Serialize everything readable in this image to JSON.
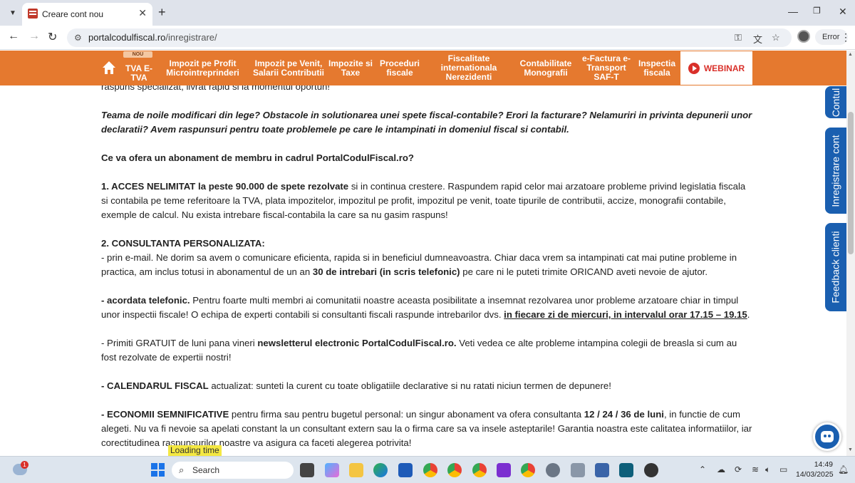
{
  "browser": {
    "tab_title": "Creare cont nou",
    "url_host": "portalcodulfiscal.ro",
    "url_path": "/inregistrare/",
    "profile_label": "Error"
  },
  "sitenav": {
    "new_badge": "NOU",
    "items": [
      {
        "label": "TVA E-TVA"
      },
      {
        "label": "Impozit pe Profit Microintreprinderi"
      },
      {
        "label": "Impozit pe Venit, Salarii Contributii"
      },
      {
        "label": "Impozite si Taxe"
      },
      {
        "label": "Proceduri fiscale"
      },
      {
        "label": "Fiscalitate internationala Nerezidenti"
      },
      {
        "label": "Contabilitate Monografii"
      },
      {
        "label": "e-Factura e-Transport SAF-T"
      },
      {
        "label": "Inspectia fiscala"
      }
    ],
    "webinar_label": "WEBINAR"
  },
  "content": {
    "intro_tail": "raspuns specializat, livrat rapid si la momentul oportun!",
    "question": "Teama de noile modificari din lege? Obstacole in solutionarea unei spete fiscal-contabile? Erori la facturare? Nelamuriri in privinta depunerii unor declaratii? Avem raspunsuri pentru toate problemele pe care le intampinati in domeniul fiscal si contabil.",
    "heading": "Ce va ofera un abonament de membru in cadrul PortalCodulFiscal.ro?",
    "p1_bold": "1. ACCES NELIMITAT la peste 90.000 de spete rezolvate",
    "p1_text": " si in continua crestere. Raspundem rapid celor mai arzatoare probleme privind legislatia fiscala si contabila pe teme referitoare la TVA, plata impozitelor, impozitul pe profit, impozitul pe venit, toate tipurile de contributii, accize, monografii contabile, exemple de calcul. Nu exista intrebare fiscal-contabila la care sa nu gasim raspuns!",
    "p2_heading": "2. CONSULTANTA PERSONALIZATA:",
    "p2_text_a": "- prin e-mail. Ne dorim sa avem o comunicare eficienta, rapida si in beneficiul dumneavoastra. Chiar daca vrem sa intampinati cat mai putine probleme in practica, am inclus totusi in abonamentul de un an ",
    "p2_bold": "30 de intrebari (in scris telefonic)",
    "p2_text_b": " pe care ni le puteti trimite ORICAND aveti nevoie de ajutor.",
    "p3_bold": "- acordata telefonic.",
    "p3_text": " Pentru foarte multi membri ai comunitatii noastre aceasta posibilitate a insemnat rezolvarea unor probleme arzatoare chiar in timpul unor inspectii fiscale! O echipa de experti contabili si consultanti fiscali raspunde intrebarilor dvs. ",
    "p3_link": "in fiecare zi de miercuri, in intervalul orar 17.15 – 19.15",
    "p3_end": ".",
    "p4_text_a": "- Primiti GRATUIT de luni pana vineri ",
    "p4_bold": "newsletterul electronic PortalCodulFiscal.ro.",
    "p4_text_b": " Veti vedea ce alte probleme intampina colegii de breasla si cum au fost rezolvate de expertii nostri!",
    "p5_bold": "- CALENDARUL FISCAL",
    "p5_text": " actualizat: sunteti la curent cu toate obligatiile declarative si nu ratati niciun termen de depunere!",
    "p6_bold": "- ECONOMII SEMNIFICATIVE",
    "p6_text_a": " pentru firma sau pentru bugetul personal: un singur abonament va ofera consultanta ",
    "p6_bold2": "12 / 24 / 36 de luni",
    "p6_text_b": ", in functie de cum alegeti. Nu va fi nevoie sa apelati constant la un consultant extern sau la o firma care sa va insele asteptarile! Garantia noastra este calitatea informatiilor, iar corectitudinea raspunsurilor noastre va asigura ca faceti alegerea potrivita!"
  },
  "sidetabs": {
    "contul": "Contul",
    "register": "Inregistrare cont",
    "feedback": "Feedback clienti"
  },
  "overlay": {
    "loading_label": "Loading time"
  },
  "taskbar": {
    "search_placeholder": "Search",
    "weather_badge": "1",
    "time": "14:49",
    "date": "14/03/2025"
  }
}
